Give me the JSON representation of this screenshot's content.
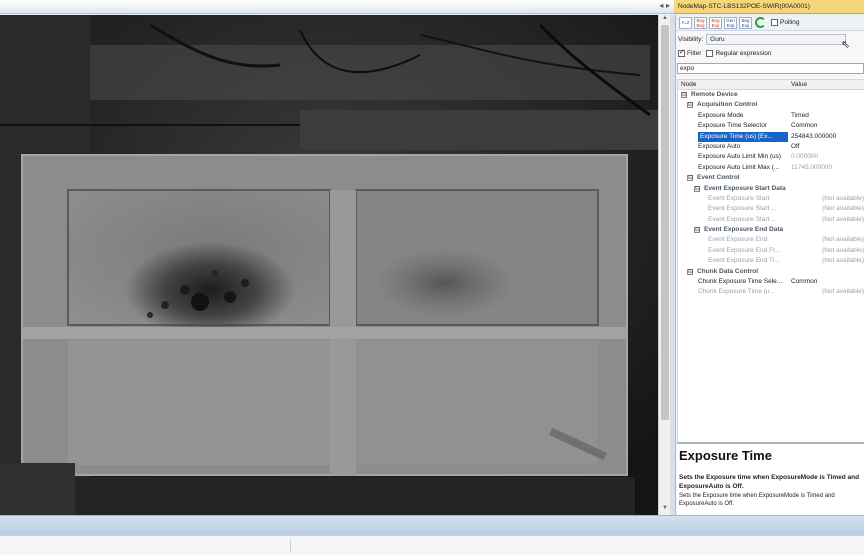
{
  "window": {
    "nodemap_title": "NodeMap-STC-LBS132POE-SWIR(00A0001)",
    "dock_controls": "◂ ▸"
  },
  "toolbar": {
    "sort_label": "A↓Z",
    "buttons": [
      "Beg Beg",
      "Beg Exp",
      "Gen Exp",
      "Beg Exp"
    ],
    "polling_label": "Polling",
    "polling_checked": false
  },
  "visibility": {
    "label": "Visibility:",
    "value": "Guru"
  },
  "filter": {
    "filter_label": "Filter",
    "filter_checked": true,
    "regex_label": "Regular expression",
    "regex_checked": false,
    "search_value": "expo"
  },
  "grid": {
    "col_node": "Node",
    "col_value": "Value",
    "rows": [
      {
        "name": "Remote Device",
        "value": "",
        "kind": "cat",
        "level": 0,
        "expander": "⊟"
      },
      {
        "name": "Acquisition Control",
        "value": "",
        "kind": "cat",
        "level": 1,
        "expander": "⊟"
      },
      {
        "name": "Exposure Mode",
        "value": "Timed",
        "kind": "item",
        "level": 2
      },
      {
        "name": "Exposure Time Selector",
        "value": "Common",
        "kind": "item",
        "level": 2
      },
      {
        "name": "Exposure Time (us) [Ex...",
        "value": "254843.000000",
        "kind": "sel",
        "level": 2
      },
      {
        "name": "Exposure Auto",
        "value": "Off",
        "kind": "item",
        "level": 2
      },
      {
        "name": "Exposure Auto Limit Min (us)",
        "value": "0.000000",
        "kind": "valdim",
        "level": 2
      },
      {
        "name": "Exposure Auto Limit Max (...",
        "value": "11745.000000",
        "kind": "valdim",
        "level": 2
      },
      {
        "name": "Event Control",
        "value": "",
        "kind": "cat",
        "level": 1,
        "expander": "⊟"
      },
      {
        "name": "Event Exposure Start Data",
        "value": "",
        "kind": "cat",
        "level": 2,
        "expander": "⊟"
      },
      {
        "name": "Event Exposure Start",
        "value": "(Not available)",
        "kind": "dim",
        "level": 3
      },
      {
        "name": "Event Exposure Start ...",
        "value": "(Not available)",
        "kind": "dim",
        "level": 3
      },
      {
        "name": "Event Exposure Start ...",
        "value": "(Not available)",
        "kind": "dim",
        "level": 3
      },
      {
        "name": "Event Exposure End Data",
        "value": "",
        "kind": "cat",
        "level": 2,
        "expander": "⊟"
      },
      {
        "name": "Event Exposure End",
        "value": "(Not available)",
        "kind": "dim",
        "level": 3
      },
      {
        "name": "Event Exposure End Fr...",
        "value": "(Not available)",
        "kind": "dim",
        "level": 3
      },
      {
        "name": "Event Exposure End Ti...",
        "value": "(Not available)",
        "kind": "dim",
        "level": 3
      },
      {
        "name": "Chunk Data Control",
        "value": "",
        "kind": "cat",
        "level": 1,
        "expander": "⊟"
      },
      {
        "name": "Chunk Exposure Time Sele...",
        "value": "Common",
        "kind": "item",
        "level": 2
      },
      {
        "name": "Chunk Exposure Time (u...",
        "value": "(Not available)",
        "kind": "dim",
        "level": 2
      }
    ]
  },
  "description": {
    "title": "Exposure Time",
    "bold_text": "Sets the Exposure time when ExposureMode is Timed and ExposureAuto is Off.",
    "text": "Sets the Exposure time when ExposureMode is Timed and ExposureAuto is Off."
  },
  "colors": {
    "selection": "#1a63c6",
    "title_highlight": "#f5d77a"
  }
}
